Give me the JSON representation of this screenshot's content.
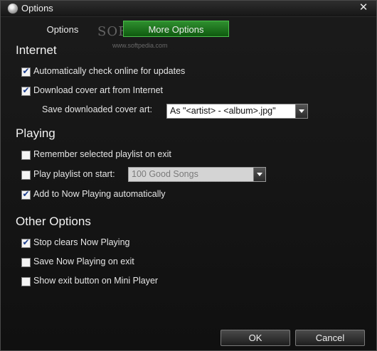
{
  "window": {
    "title": "Options",
    "close_glyph": "✕"
  },
  "tabs": [
    {
      "label": "Options",
      "active": false
    },
    {
      "label": "More Options",
      "active": true
    }
  ],
  "watermark": {
    "text": "SOFTPEDIA",
    "url": "www.softpedia.com"
  },
  "sections": {
    "internet": {
      "heading": "Internet",
      "auto_check": {
        "label": "Automatically check online for updates",
        "checked": true
      },
      "download_cover": {
        "label": "Download cover art from Internet",
        "checked": true
      },
      "save_cover_label": "Save downloaded cover art:",
      "save_cover_value": "As \"<artist> - <album>.jpg\""
    },
    "playing": {
      "heading": "Playing",
      "remember_playlist": {
        "label": "Remember selected playlist on exit",
        "checked": false
      },
      "play_on_start": {
        "label": "Play playlist on start:",
        "checked": false,
        "playlist": "100 Good Songs"
      },
      "add_now_playing": {
        "label": "Add to Now Playing automatically",
        "checked": true
      }
    },
    "other": {
      "heading": "Other Options",
      "stop_clears": {
        "label": "Stop clears Now Playing",
        "checked": true
      },
      "save_now_playing": {
        "label": "Save Now Playing on exit",
        "checked": false
      },
      "show_exit": {
        "label": "Show exit button on Mini Player",
        "checked": false
      }
    }
  },
  "buttons": {
    "ok": "OK",
    "cancel": "Cancel"
  },
  "colors": {
    "accent": "#1f7a1f",
    "window_bg": "#141414",
    "text": "#e6e6e6",
    "check": "#1d3f8f"
  },
  "icons": {
    "app": "disc-icon",
    "close": "close-icon",
    "check": "checkmark-icon",
    "dropdown": "chevron-down-icon"
  }
}
